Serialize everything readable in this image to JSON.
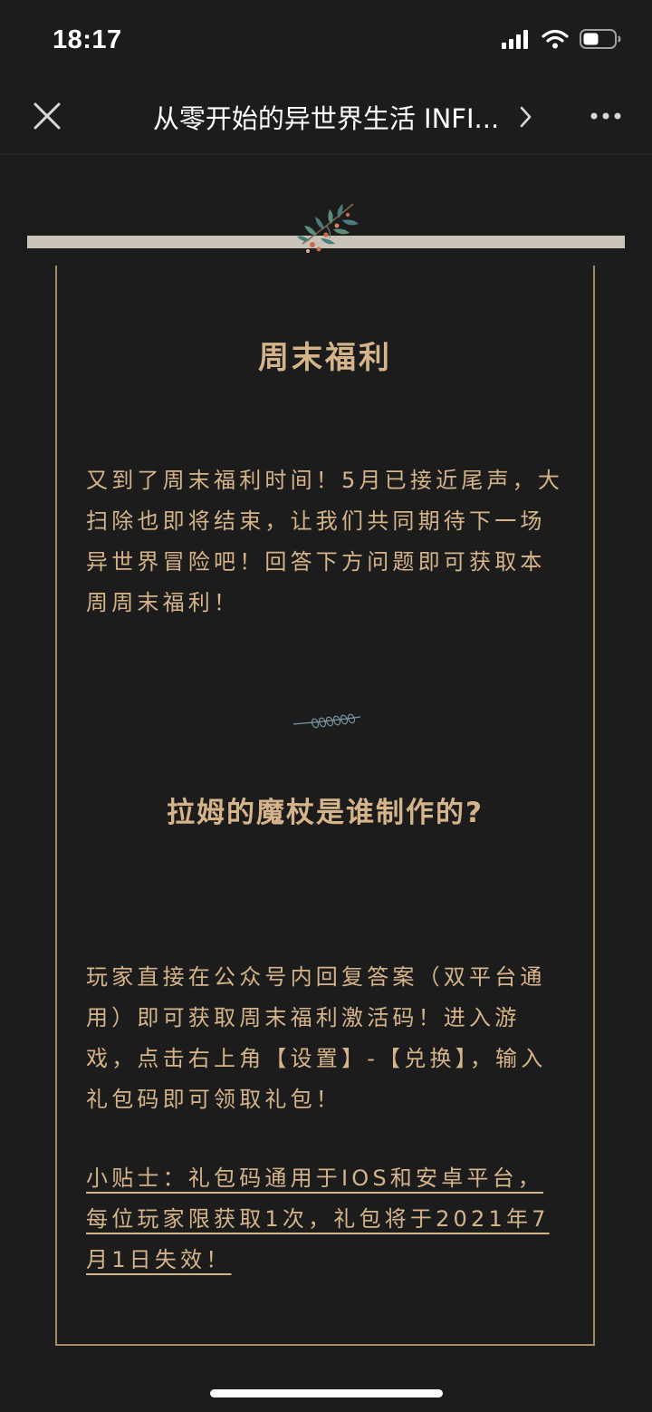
{
  "status_bar": {
    "time": "18:17"
  },
  "nav": {
    "title": "从零开始的异世界生活 INFI..."
  },
  "article": {
    "title": "周末福利",
    "intro": "又到了周末福利时间！5月已接近尾声，大扫除也即将结束，让我们共同期待下一场异世界冒险吧！回答下方问题即可获取本周周末福利！",
    "question": "拉姆的魔杖是谁制作的?",
    "instructions": "玩家直接在公众号内回复答案（双平台通用）即可获取周末福利激活码！进入游戏，点击右上角【设置】-【兑换】，输入礼包码即可领取礼包！",
    "tip": "小贴士：礼包码通用于IOS和安卓平台，每位玩家限获取1次，礼包将于2021年7月1日失效！"
  },
  "icons": {
    "close": "close-icon",
    "chevron": "chevron-right-icon",
    "more": "more-dots-icon",
    "signal": "cellular-signal-icon",
    "wifi": "wifi-icon",
    "battery": "battery-icon"
  },
  "colors": {
    "background": "#1c1c1c",
    "gold_text": "#d5b48a",
    "frame_line": "#a38a63",
    "rod": "#c9c3b8"
  }
}
